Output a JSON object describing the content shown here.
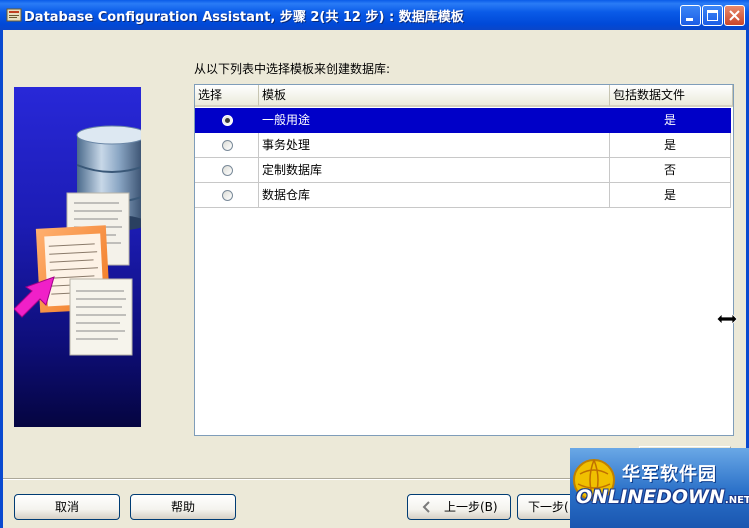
{
  "window": {
    "title": "Database Configuration Assistant, 步骤 2(共 12 步) : 数据库模板"
  },
  "instruction": "从以下列表中选择模板来创建数据库:",
  "table": {
    "headers": [
      "选择",
      "模板",
      "包括数据文件"
    ],
    "rows": [
      {
        "template": "一般用途",
        "includes_datafiles": "是",
        "selected": true
      },
      {
        "template": "事务处理",
        "includes_datafiles": "是",
        "selected": false
      },
      {
        "template": "定制数据库",
        "includes_datafiles": "否",
        "selected": false
      },
      {
        "template": "数据仓库",
        "includes_datafiles": "是",
        "selected": false
      }
    ]
  },
  "buttons": {
    "cancel": "取消",
    "help": "帮助",
    "back": "上一步(B)",
    "next": "下一步("
  },
  "watermark": {
    "chinese": "华军软件园",
    "english": "ONLINEDOWN",
    "tld": ".NET"
  },
  "colors": {
    "titlebar": "#0a5be8",
    "selection": "#0000c8",
    "background": "#ece9d8"
  },
  "icons": [
    "app-icon",
    "minimize-icon",
    "maximize-icon",
    "close-icon",
    "back-arrow-icon",
    "resize-cursor-icon"
  ]
}
